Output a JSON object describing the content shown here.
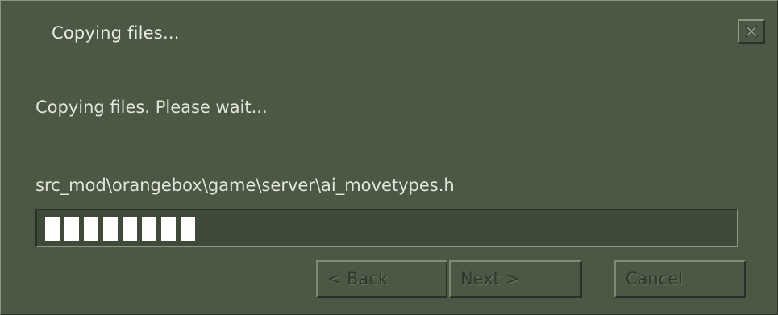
{
  "dialog": {
    "title": "Copying files...",
    "message": "Copying files. Please wait...",
    "current_file": "src_mod\\orangebox\\game\\server\\ai_movetypes.h",
    "progress_fraction": 0.21,
    "buttons": {
      "back_label": "< Back",
      "next_label": "Next >",
      "cancel_label": "Cancel"
    },
    "close_icon": "close-icon"
  },
  "colors": {
    "background": "#4c5844",
    "text": "#dfe5d8",
    "disabled_text": "#2f372a",
    "progress_segment": "#ffffff"
  }
}
